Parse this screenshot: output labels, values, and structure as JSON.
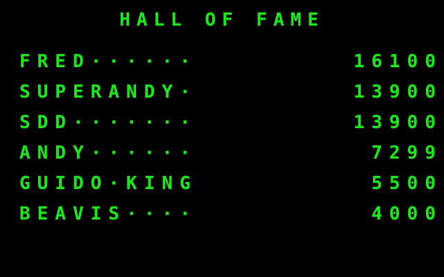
{
  "title": "HALL OF FAME",
  "entries": [
    {
      "name": "FRED······",
      "score": "16100"
    },
    {
      "name": "SUPERANDY·",
      "score": "13900"
    },
    {
      "name": "SDD·······",
      "score": "13900"
    },
    {
      "name": "ANDY······",
      "score": "7299"
    },
    {
      "name": "GUIDO·KING",
      "score": "5500"
    },
    {
      "name": "BEAVIS····",
      "score": "4000"
    }
  ],
  "colors": {
    "text": "#1ee61e",
    "background": "#000000"
  }
}
